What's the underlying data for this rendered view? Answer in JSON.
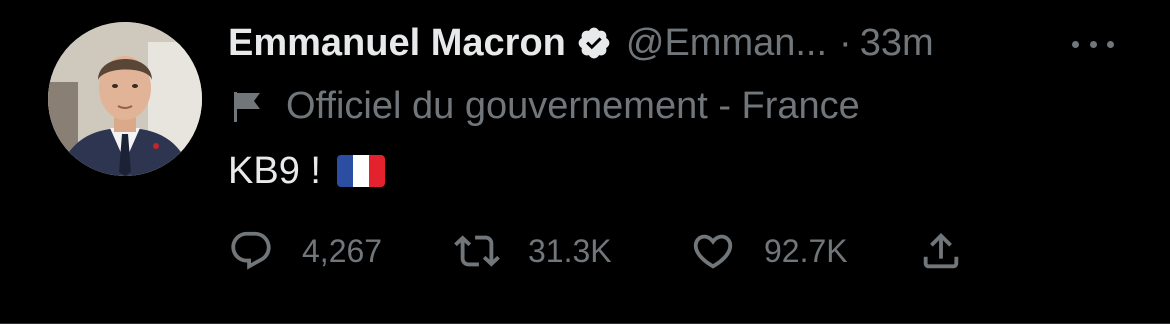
{
  "author": {
    "display_name": "Emmanuel Macron",
    "verified": true,
    "handle": "@Emman...",
    "separator": "·",
    "timestamp": "33m"
  },
  "label": {
    "icon": "flag-icon",
    "text": "Officiel du gouvernement - France"
  },
  "tweet": {
    "text": "KB9 !",
    "emoji": "french-flag-emoji"
  },
  "actions": {
    "reply_count": "4,267",
    "retweet_count": "31.3K",
    "like_count": "92.7K"
  },
  "colors": {
    "background": "#000000",
    "primary_text": "#e7e9ea",
    "secondary_text": "#71767b",
    "flag_blue": "#2b4ea2",
    "flag_white": "#ffffff",
    "flag_red": "#e4222d"
  }
}
